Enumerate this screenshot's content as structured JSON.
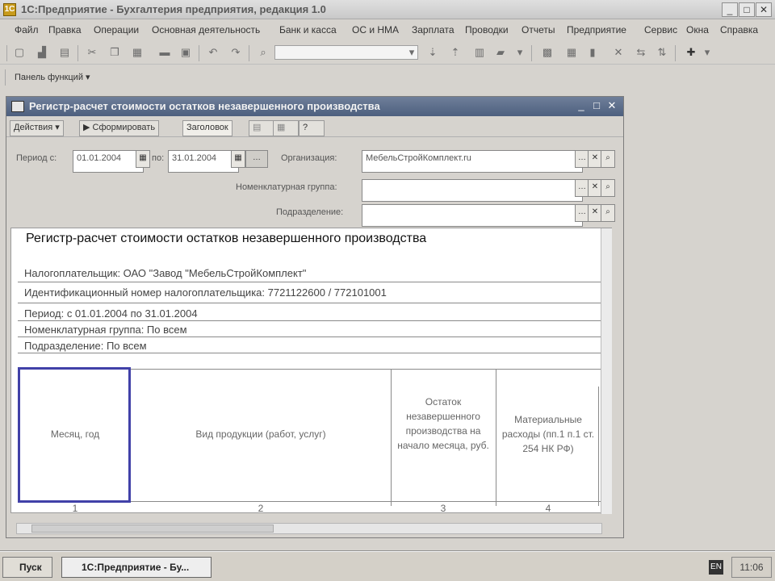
{
  "app": {
    "title": "1С:Предприятие - Бухгалтерия предприятия, редакция 1.0",
    "icon_glyph": "1С"
  },
  "window_controls": {
    "minimize": "_",
    "maximize": "□",
    "close": "✕"
  },
  "menubar": {
    "items": [
      "Файл",
      "Правка",
      "Операции",
      "Основная деятельность",
      "Банк и касса",
      "ОС и НМА",
      "Зарплата",
      "Проводки",
      "Отчеты",
      "Предприятие",
      "Сервис",
      "Окна",
      "Справка"
    ]
  },
  "toolbar2": {
    "quick_functions_label": "Панель функций"
  },
  "doc": {
    "title": "Регистр-расчет стоимости остатков незавершенного производства",
    "toolbar": {
      "actions": "Действия ▾",
      "generate": "Сформировать",
      "header": "Заголовок",
      "help": "?"
    },
    "form": {
      "period_label": "Период с:",
      "period_from": "01.01.2004",
      "period_to_label": "по:",
      "period_to": "31.01.2004",
      "org_label": "Организация:",
      "org_value": "МебельСтройКомплект.ru",
      "group_label": "Номенклатурная группа:",
      "group_value": "",
      "division_label": "Подразделение:",
      "division_value": ""
    },
    "report": {
      "title": "Регистр-расчет стоимости остатков незавершенного производства",
      "lines": [
        "Налогоплательщик: ОАО \"Завод \"МебельСтройКомплект\"",
        "Идентификационный номер налогоплательщика: 7721122600 / 772101001",
        "Период: с 01.01.2004 по 31.01.2004",
        "Номенклатурная группа: По всем",
        "Подразделение: По всем"
      ],
      "columns": [
        {
          "header": "Месяц, год",
          "number": "1"
        },
        {
          "header": "Вид продукции (работ, услуг)",
          "number": "2"
        },
        {
          "header": "Остаток незавершенного производства на начало месяца, руб.",
          "number": "3"
        },
        {
          "header": "Материальные расходы (пп.1 п.1 ст. 254 НК РФ)",
          "number": "4"
        }
      ]
    }
  },
  "taskbar": {
    "start_label": "Пуск",
    "task_label": "1С:Предприятие - Бу...",
    "lang": "EN",
    "clock": "11:06"
  }
}
